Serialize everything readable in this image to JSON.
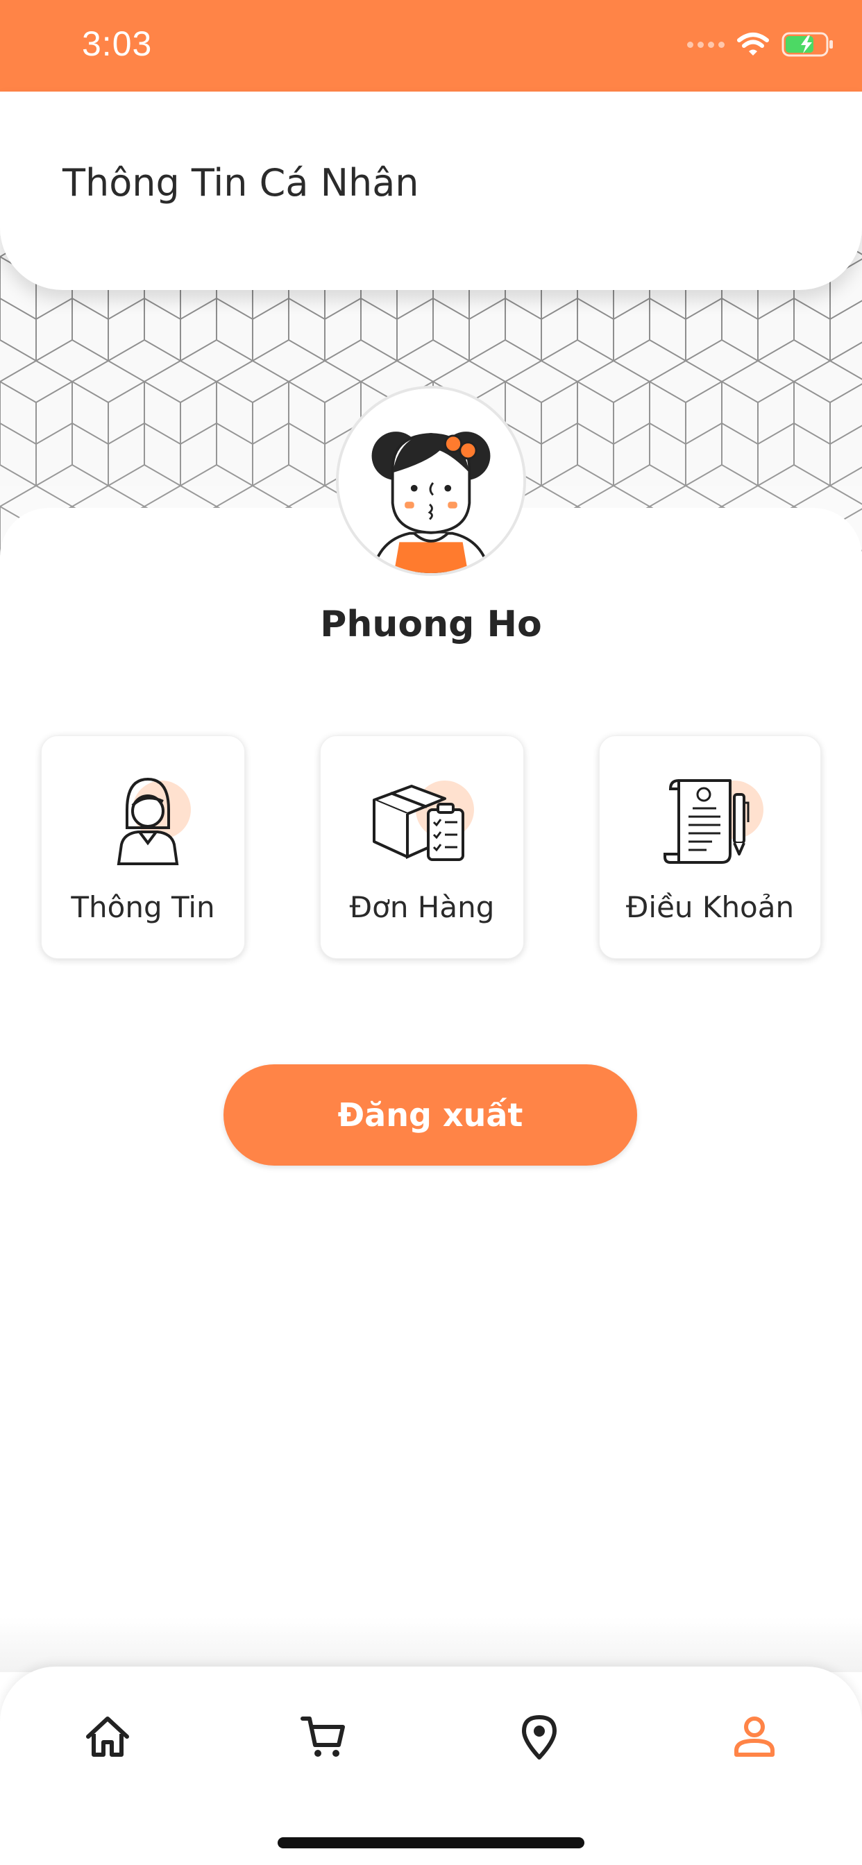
{
  "status_bar": {
    "time": "3:03",
    "icons": [
      "signal-dots-icon",
      "wifi-icon",
      "battery-charging-icon"
    ]
  },
  "header": {
    "title": "Thông Tin Cá Nhân"
  },
  "profile": {
    "name": "Phuong Ho",
    "avatar_icon": "girl-avatar-icon"
  },
  "menu": [
    {
      "label": "Thông Tin",
      "icon": "user-profile-icon"
    },
    {
      "label": "Đơn Hàng",
      "icon": "box-checklist-icon"
    },
    {
      "label": "Điều Khoản",
      "icon": "document-pen-icon"
    }
  ],
  "logout": {
    "label": "Đăng xuất"
  },
  "bottom_nav": [
    {
      "icon": "home-icon",
      "active": false
    },
    {
      "icon": "cart-icon",
      "active": false
    },
    {
      "icon": "location-pin-icon",
      "active": false
    },
    {
      "icon": "person-icon",
      "active": true
    }
  ],
  "colors": {
    "primary": "#ff8447",
    "accent_light": "#ffe1cf",
    "text_dark": "#262626",
    "nav_inactive": "#222222"
  }
}
